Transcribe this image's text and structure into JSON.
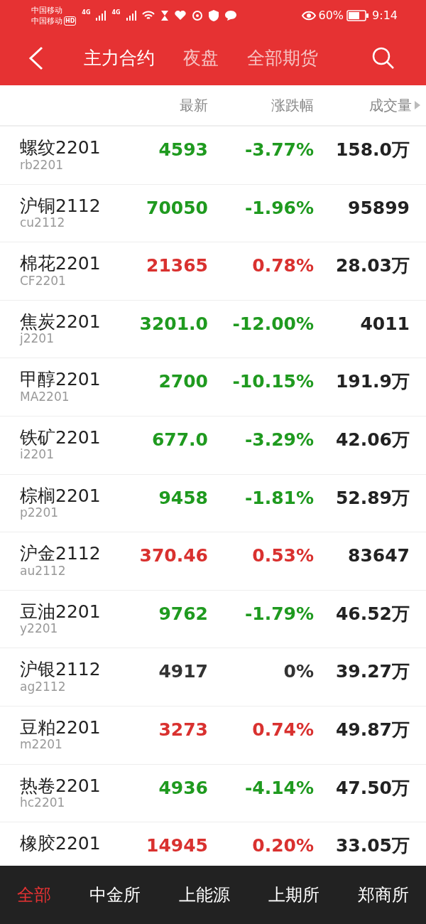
{
  "status_bar": {
    "carrier_1": "中国移动",
    "carrier_2": "中国移动",
    "hd": "HD",
    "network_1": "4G",
    "network_2": "4G",
    "battery": "60%",
    "time": "9:14"
  },
  "header": {
    "tabs": [
      {
        "label": "主力合约",
        "selected": true
      },
      {
        "label": "夜盘",
        "selected": false
      },
      {
        "label": "全部期货",
        "selected": false
      }
    ]
  },
  "table": {
    "columns": [
      "最新",
      "涨跌幅",
      "成交量"
    ],
    "rows": [
      {
        "name": "螺纹2201",
        "code": "rb2201",
        "price": "4593",
        "change": "-3.77%",
        "volume": "158.0万",
        "color": "#1f9a1f"
      },
      {
        "name": "沪铜2112",
        "code": "cu2112",
        "price": "70050",
        "change": "-1.96%",
        "volume": "95899",
        "color": "#1f9a1f"
      },
      {
        "name": "棉花2201",
        "code": "CF2201",
        "price": "21365",
        "change": "0.78%",
        "volume": "28.03万",
        "color": "#d9312f"
      },
      {
        "name": "焦炭2201",
        "code": "j2201",
        "price": "3201.0",
        "change": "-12.00%",
        "volume": "4011",
        "color": "#1f9a1f"
      },
      {
        "name": "甲醇2201",
        "code": "MA2201",
        "price": "2700",
        "change": "-10.15%",
        "volume": "191.9万",
        "color": "#1f9a1f"
      },
      {
        "name": "铁矿2201",
        "code": "i2201",
        "price": "677.0",
        "change": "-3.29%",
        "volume": "42.06万",
        "color": "#1f9a1f"
      },
      {
        "name": "棕榈2201",
        "code": "p2201",
        "price": "9458",
        "change": "-1.81%",
        "volume": "52.89万",
        "color": "#1f9a1f"
      },
      {
        "name": "沪金2112",
        "code": "au2112",
        "price": "370.46",
        "change": "0.53%",
        "volume": "83647",
        "color": "#d9312f"
      },
      {
        "name": "豆油2201",
        "code": "y2201",
        "price": "9762",
        "change": "-1.79%",
        "volume": "46.52万",
        "color": "#1f9a1f"
      },
      {
        "name": "沪银2112",
        "code": "ag2112",
        "price": "4917",
        "change": "0%",
        "volume": "39.27万",
        "color": "#333333"
      },
      {
        "name": "豆粕2201",
        "code": "m2201",
        "price": "3273",
        "change": "0.74%",
        "volume": "49.87万",
        "color": "#d9312f"
      },
      {
        "name": "热卷2201",
        "code": "hc2201",
        "price": "4936",
        "change": "-4.14%",
        "volume": "47.50万",
        "color": "#1f9a1f"
      },
      {
        "name": "橡胶2201",
        "price": "14945",
        "change": "0.20%",
        "volume": "33.05万",
        "color": "#d9312f"
      }
    ]
  },
  "bottom_tabs": [
    {
      "label": "全部",
      "selected": true
    },
    {
      "label": "中金所",
      "selected": false
    },
    {
      "label": "上能源",
      "selected": false
    },
    {
      "label": "上期所",
      "selected": false
    },
    {
      "label": "郑商所",
      "selected": false
    }
  ]
}
